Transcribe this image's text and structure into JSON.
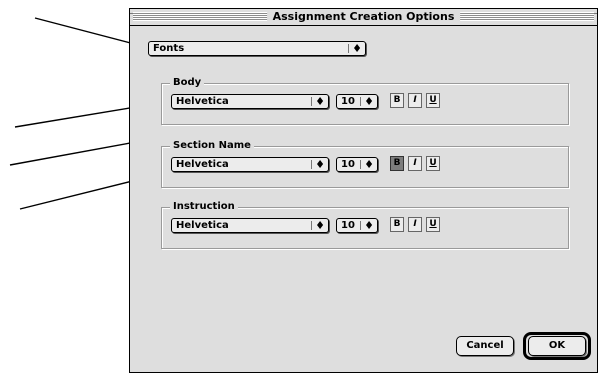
{
  "window": {
    "title": "Assignment Creation Options"
  },
  "category_popup": {
    "selected": "Fonts",
    "arrow_glyph": "♦"
  },
  "groups": [
    {
      "label": "Body",
      "font": "Helvetica",
      "size": "10",
      "bold_on": false,
      "italic_on": false,
      "underline_on": false
    },
    {
      "label": "Section Name",
      "font": "Helvetica",
      "size": "10",
      "bold_on": true,
      "italic_on": false,
      "underline_on": false
    },
    {
      "label": "Instruction",
      "font": "Helvetica",
      "size": "10",
      "bold_on": false,
      "italic_on": false,
      "underline_on": false
    }
  ],
  "style_buttons": {
    "bold": "B",
    "italic": "I",
    "underline": "U"
  },
  "buttons": {
    "cancel": "Cancel",
    "ok": "OK"
  },
  "icons": {
    "popup_arrows": "updown-arrows-icon",
    "callout": "callout-arrow-icon"
  }
}
